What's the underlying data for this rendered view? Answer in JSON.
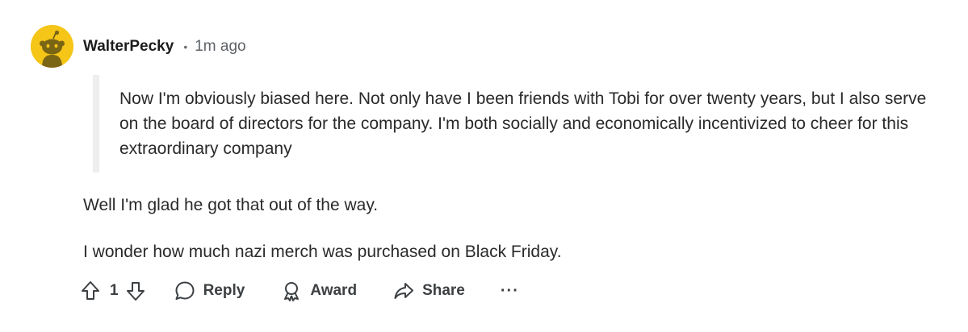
{
  "comment": {
    "username": "WalterPecky",
    "separator": "•",
    "timestamp": "1m ago",
    "avatar_icon": "snoo-avatar-icon",
    "avatar_color": "#f5c518",
    "quote": "Now I'm obviously biased here. Not only have I been friends with Tobi for over twenty years, but I also serve on the board of directors for the company. I'm both socially and economically incentivized to cheer for this extraordinary company",
    "paragraphs": [
      "Well I'm glad he got that out of the way.",
      "I wonder how much nazi merch was purchased on Black Friday."
    ]
  },
  "actions": {
    "upvote_icon": "upvote-arrow-icon",
    "vote_count": "1",
    "downvote_icon": "downvote-arrow-icon",
    "reply_label": "Reply",
    "reply_icon": "speech-bubble-icon",
    "award_label": "Award",
    "award_icon": "award-ribbon-icon",
    "share_label": "Share",
    "share_icon": "share-arrow-icon",
    "more_label": "···"
  }
}
